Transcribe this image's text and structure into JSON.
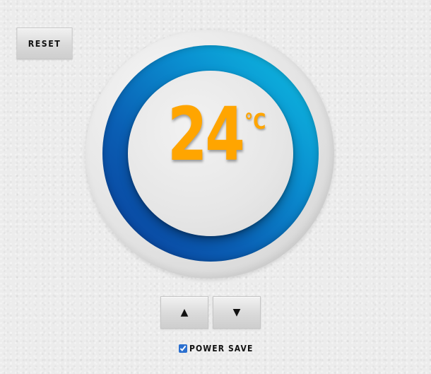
{
  "controls": {
    "reset_label": "RESET",
    "up_label": "▲",
    "down_label": "▼"
  },
  "thermostat": {
    "temperature": "24",
    "unit": "°C"
  },
  "power_save": {
    "label": "POWER SAVE",
    "checked": true
  },
  "colors": {
    "temperature_text": "#ffa500",
    "ring_light": "#0fc3e3",
    "ring_dark": "#0a3c98",
    "background": "#ececec"
  }
}
